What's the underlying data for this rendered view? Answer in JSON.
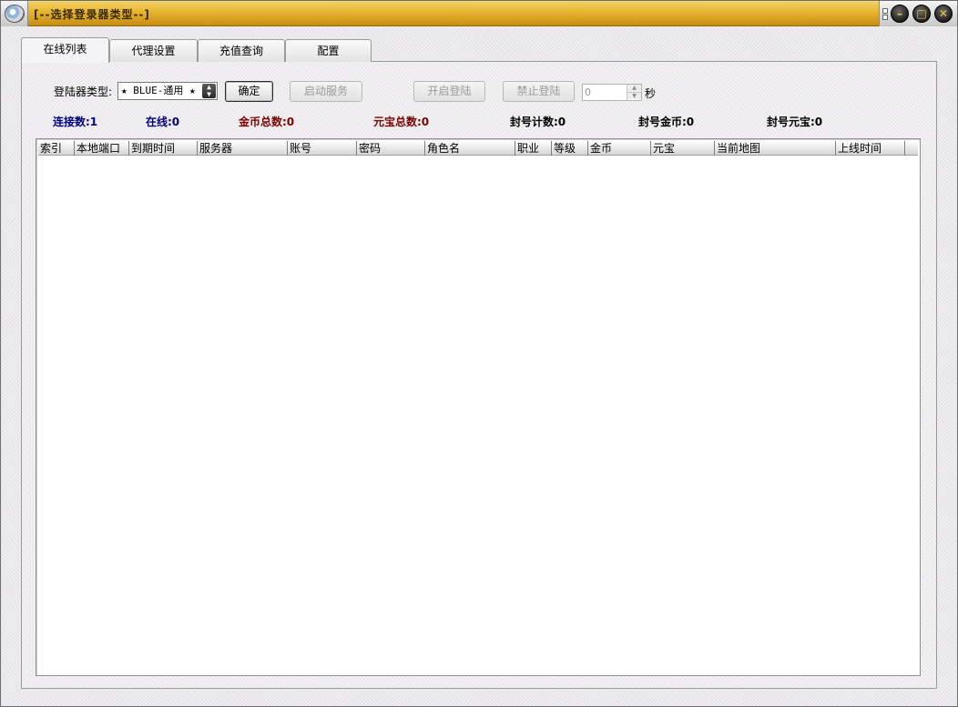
{
  "window": {
    "title": "[--选择登录器类型--]"
  },
  "tabs": [
    {
      "label": "在线列表",
      "active": true
    },
    {
      "label": "代理设置",
      "active": false
    },
    {
      "label": "充值查询",
      "active": false
    },
    {
      "label": "配置",
      "active": false
    }
  ],
  "toolbar": {
    "launcher_type_label": "登陆器类型:",
    "launcher_type_value": "★ BLUE-通用 ★",
    "confirm_label": "确定",
    "start_service_label": "启动服务",
    "enable_login_label": "开启登陆",
    "disable_login_label": "禁止登陆",
    "seconds_value": "0",
    "seconds_unit": "秒"
  },
  "stats": {
    "connections": "连接数:1",
    "online": "在线:0",
    "gold_total": "金币总数:0",
    "ingot_total": "元宝总数:0",
    "banned_count": "封号计数:0",
    "banned_gold": "封号金币:0",
    "banned_ingot": "封号元宝:0",
    "colors": {
      "connections": "#00007f",
      "online": "#00007f",
      "gold_total": "#7f0000",
      "ingot_total": "#7f0000",
      "banned": "#000000"
    }
  },
  "table": {
    "columns": [
      "索引",
      "本地端口",
      "到期时间",
      "服务器",
      "账号",
      "密码",
      "角色名",
      "职业",
      "等级",
      "金币",
      "元宝",
      "当前地图",
      "上线时间"
    ],
    "rows": []
  }
}
